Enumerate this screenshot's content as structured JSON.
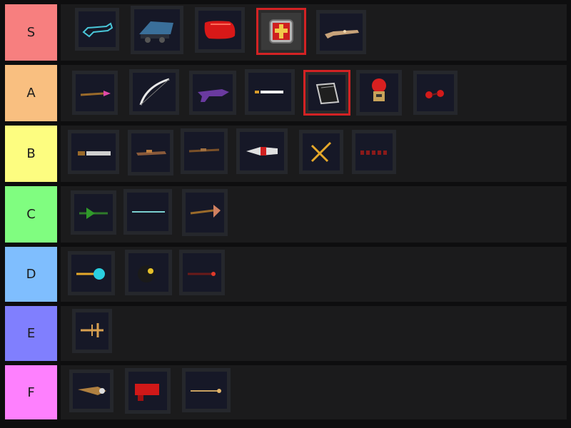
{
  "tiers": [
    {
      "label": "S",
      "color": "#f77f7f",
      "items": [
        {
          "icon": "cyan-outline-blaster-icon"
        },
        {
          "icon": "blue-tank-cannon-icon"
        },
        {
          "icon": "red-boxing-glove-icon"
        },
        {
          "icon": "golden-cross-shield-icon",
          "selected": true
        },
        {
          "icon": "ornate-rifle-icon"
        }
      ]
    },
    {
      "label": "A",
      "color": "#f9bf80",
      "items": [
        {
          "icon": "pink-magic-staff-icon"
        },
        {
          "icon": "white-bow-icon"
        },
        {
          "icon": "purple-blaster-icon"
        },
        {
          "icon": "golden-hilt-sword-icon"
        },
        {
          "icon": "black-spellbook-icon",
          "selected": true
        },
        {
          "icon": "red-capped-mushroom-bomb-icon"
        },
        {
          "icon": "red-crystal-wand-icon"
        }
      ]
    },
    {
      "label": "B",
      "color": "#fdfd80",
      "items": [
        {
          "icon": "broadsword-icon"
        },
        {
          "icon": "brown-rifle-icon"
        },
        {
          "icon": "musket-icon"
        },
        {
          "icon": "red-rocket-launcher-icon"
        },
        {
          "icon": "golden-crossbow-icon"
        },
        {
          "icon": "red-chain-whip-icon"
        }
      ]
    },
    {
      "label": "C",
      "color": "#80fd80",
      "items": [
        {
          "icon": "green-leaf-spear-icon"
        },
        {
          "icon": "teal-lance-icon"
        },
        {
          "icon": "feathered-staff-icon"
        }
      ]
    },
    {
      "label": "D",
      "color": "#7fbefe",
      "items": [
        {
          "icon": "cyan-orb-gauntlet-icon"
        },
        {
          "icon": "black-bomb-icon"
        },
        {
          "icon": "red-laser-pointer-icon"
        }
      ]
    },
    {
      "label": "E",
      "color": "#807ffe",
      "items": [
        {
          "icon": "golden-trident-icon"
        }
      ]
    },
    {
      "label": "F",
      "color": "#fe80fe",
      "items": [
        {
          "icon": "drill-cannon-icon"
        },
        {
          "icon": "red-megaphone-gun-icon"
        },
        {
          "icon": "golden-fishing-rod-icon"
        }
      ]
    }
  ]
}
